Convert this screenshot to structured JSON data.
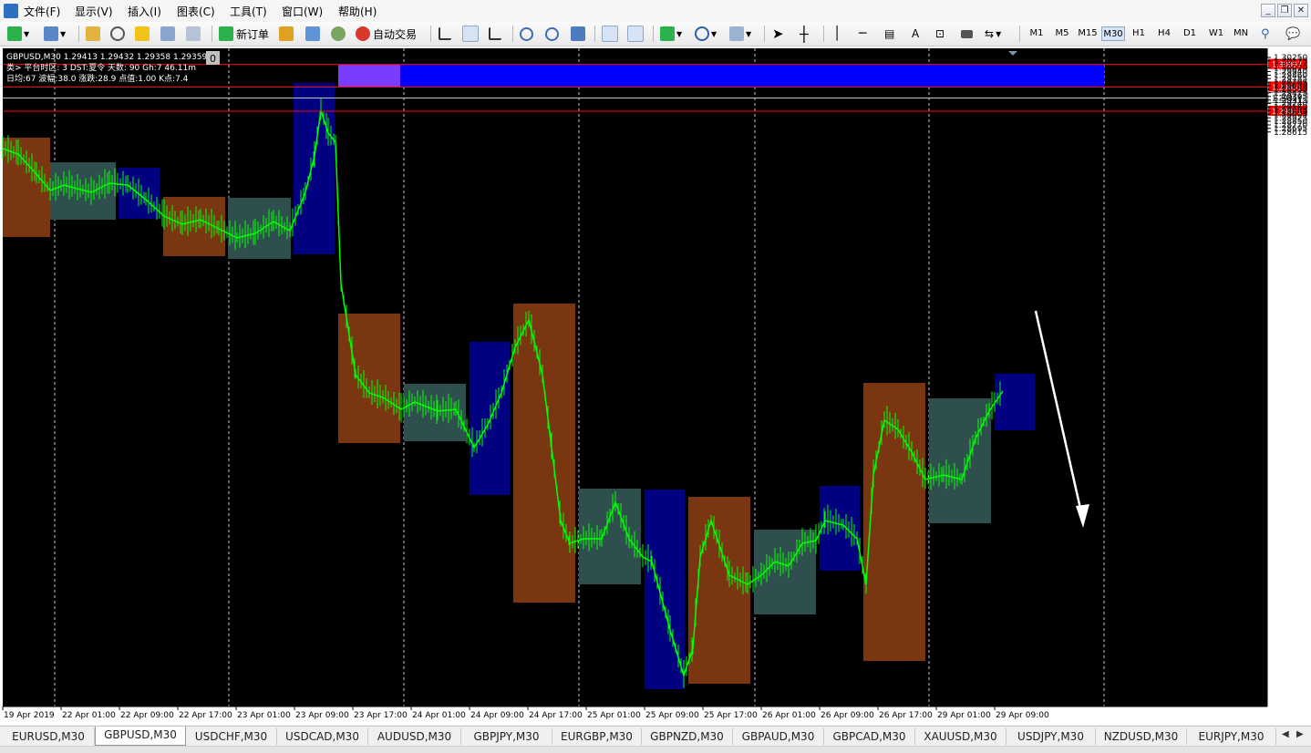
{
  "menu": {
    "items": [
      "文件(F)",
      "显示(V)",
      "插入(I)",
      "图表(C)",
      "工具(T)",
      "窗口(W)",
      "帮助(H)"
    ]
  },
  "toolbar": {
    "new_order_label": "新订单",
    "auto_trade_label": "自动交易",
    "timeframes": [
      "M1",
      "M5",
      "M15",
      "M30",
      "H1",
      "H4",
      "D1",
      "W1",
      "MN"
    ],
    "active_timeframe": "M30"
  },
  "chart": {
    "info_line1": "GBPUSD,M30  1.29413 1.29432 1.29358 1.29359",
    "info_line2": "类> 平台时区: 3  DST:夏令 天数: 90  Gh:7  46.11m",
    "info_line3": "日均:67  波幅:38.0  涨跌:28.9  点值:1.00  K点:7.4",
    "badge": "0",
    "price_labels": [
      "1.30250",
      "1.30175",
      "1.30020",
      "1.29940",
      "1.29860",
      "1.29785",
      "1.29705",
      "1.29630",
      "1.29550",
      "1.29475",
      "1.29395",
      "1.29315",
      "1.29240",
      "1.29160",
      "1.29085",
      "1.29005",
      "1.28925",
      "1.28850",
      "1.28770",
      "1.28695",
      "1.28615"
    ],
    "hline_labels": [
      "1.30097",
      "1.29601",
      "1.29071"
    ],
    "current_price": "1.29359",
    "time_labels": [
      "19 Apr 2019",
      "22 Apr 01:00",
      "22 Apr 09:00",
      "22 Apr 17:00",
      "23 Apr 01:00",
      "23 Apr 09:00",
      "23 Apr 17:00",
      "24 Apr 01:00",
      "24 Apr 09:00",
      "24 Apr 17:00",
      "25 Apr 01:00",
      "25 Apr 09:00",
      "25 Apr 17:00",
      "26 Apr 01:00",
      "26 Apr 09:00",
      "26 Apr 17:00",
      "29 Apr 01:00",
      "29 Apr 09:00"
    ],
    "colors": {
      "background": "#000000",
      "candles": "#00ff00",
      "zone": "#0000ff",
      "zone_overlap": "#7a3cff",
      "box_brown": "#7a3511",
      "box_teal": "#2f4f4f",
      "box_navy": "#000080",
      "hline": "#ff0000",
      "current_line": "#c0c0c0"
    }
  },
  "tabs": {
    "items": [
      "EURUSD,M30",
      "GBPUSD,M30",
      "USDCHF,M30",
      "USDCAD,M30",
      "AUDUSD,M30",
      "GBPJPY,M30",
      "EURGBP,M30",
      "GBPNZD,M30",
      "GBPAUD,M30",
      "GBPCAD,M30",
      "XAUUSD,M30",
      "USDJPY,M30",
      "NZDUSD,M30",
      "EURJPY,M30"
    ],
    "active": "GBPUSD,M30"
  }
}
